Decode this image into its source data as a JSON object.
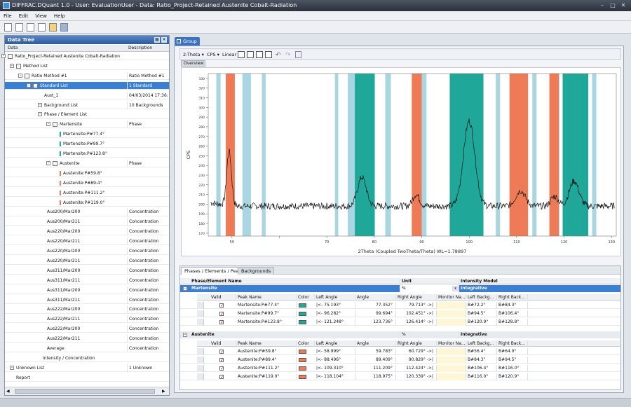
{
  "window": {
    "title": "DIFFRAC.DQuant 1.0 - User: EvaluationUser - Data: Ratio_Project-Retained Austenite Cobalt-Radiation",
    "min": "–",
    "max": "□",
    "close": "✕"
  },
  "menu": [
    "File",
    "Edit",
    "View",
    "Help"
  ],
  "toolbar": {
    "icons": [
      "new-document-icon",
      "open-document-icon",
      "document-icon",
      "document-icon",
      "open-folder-icon",
      "save-icon"
    ]
  },
  "data_tree": {
    "title": "Data Tree",
    "col_data": "Data",
    "col_description": "Description",
    "rows": [
      {
        "label": "Ratio_Project-Retained Austenite Cobalt-Radiation",
        "desc": ""
      },
      {
        "label": "Method List",
        "desc": ""
      },
      {
        "label": "Ratio Method #1",
        "desc": "Ratio Method #1"
      },
      {
        "label": "Standard List",
        "desc": "1 Standard"
      },
      {
        "label": "Aust_1",
        "desc": "04/03/2014 17:36:36"
      },
      {
        "label": "Background List",
        "desc": "10 Backgrounds"
      },
      {
        "label": "Phase / Element List",
        "desc": ""
      },
      {
        "label": "Martensite",
        "desc": "Phase"
      },
      {
        "label": "Martensite:P#77.4°",
        "desc": ""
      },
      {
        "label": "Martensite:P#99.7°",
        "desc": ""
      },
      {
        "label": "Martensite:P#123.8°",
        "desc": ""
      },
      {
        "label": "Austenite",
        "desc": "Phase"
      },
      {
        "label": "Austenite:P#59.8°",
        "desc": ""
      },
      {
        "label": "Austenite:P#89.4°",
        "desc": ""
      },
      {
        "label": "Austenite:P#111.2°",
        "desc": ""
      },
      {
        "label": "Austenite:P#119.0°",
        "desc": ""
      },
      {
        "label": "Aus200/Mar200",
        "desc": "Concentration"
      },
      {
        "label": "Aus200/Mar211",
        "desc": "Concentration"
      },
      {
        "label": "Aus220/Mar200",
        "desc": "Concentration"
      },
      {
        "label": "Aus220/Mar211",
        "desc": "Concentration"
      },
      {
        "label": "Aus220/Mar200",
        "desc": "Concentration"
      },
      {
        "label": "Aus220/Mar211",
        "desc": "Concentration"
      },
      {
        "label": "Aus311/Mar200",
        "desc": "Concentration"
      },
      {
        "label": "Aus311/Mar211",
        "desc": "Concentration"
      },
      {
        "label": "Aus311/Mar200",
        "desc": "Concentration"
      },
      {
        "label": "Aus311/Mar211",
        "desc": "Concentration"
      },
      {
        "label": "Aus222/Mar200",
        "desc": "Concentration"
      },
      {
        "label": "Aus222/Mar211",
        "desc": "Concentration"
      },
      {
        "label": "Aus222/Mar200",
        "desc": "Concentration"
      },
      {
        "label": "Aus222/Mar211",
        "desc": "Concentration"
      },
      {
        "label": "Average",
        "desc": "Concentration"
      },
      {
        "label": "Intensity / Concentration",
        "desc": ""
      },
      {
        "label": "Unknown List",
        "desc": "1 Unknown"
      },
      {
        "label": "Report",
        "desc": ""
      }
    ]
  },
  "group_tab": "Group",
  "chart_toolbar": {
    "xmode": "2-Theta",
    "ymode": "CPS",
    "scale": "Linear"
  },
  "overview_tab": "Overview",
  "chart_data": {
    "type": "line",
    "xlabel": "2Theta (Coupled TwoTheta/Theta) WL=1.78897",
    "ylabel": "CPS",
    "xlim": [
      45,
      131
    ],
    "ylim": [
      167,
      335
    ],
    "xticks": [
      50,
      60,
      70,
      80,
      90,
      100,
      110,
      120,
      130
    ],
    "xtick_labels": [
      "50",
      "",
      "70",
      "80",
      "90",
      "100",
      "110",
      "120",
      "130"
    ],
    "yticks": [
      170,
      180,
      190,
      200,
      210,
      220,
      230,
      240,
      250,
      260,
      270,
      280,
      290,
      300,
      310,
      320,
      330
    ],
    "martensite_color": "#1fa89a",
    "austenite_color": "#ef7a56",
    "background_color": "#a9d6e0",
    "background_bands": [
      [
        46.7,
        47.6
      ],
      [
        52.2,
        54.0
      ],
      [
        56.3,
        57.1
      ],
      [
        71.7,
        72.4
      ],
      [
        74.4,
        76.4
      ],
      [
        82.3,
        83.5
      ],
      [
        90.0,
        91.0
      ],
      [
        105.6,
        106.5
      ],
      [
        113.3,
        114.2
      ],
      [
        118.3,
        119.0
      ],
      [
        125.9,
        126.8
      ]
    ],
    "martensite_bands": [
      [
        75.9,
        80.1
      ],
      [
        95.9,
        103.0
      ],
      [
        119.7,
        125.1
      ]
    ],
    "austenite_bands": [
      [
        48.7,
        50.6
      ],
      [
        87.9,
        90.0
      ],
      [
        108.5,
        112.4
      ],
      [
        116.9,
        118.9
      ]
    ],
    "baseline": 198,
    "peaks": [
      {
        "x": 49.4,
        "height": 56,
        "width": 0.5
      },
      {
        "x": 77.4,
        "height": 30,
        "width": 0.9
      },
      {
        "x": 88.8,
        "height": 12,
        "width": 0.7
      },
      {
        "x": 100.0,
        "height": 88,
        "width": 1.2
      },
      {
        "x": 110.8,
        "height": 16,
        "width": 1.0
      },
      {
        "x": 118.0,
        "height": 10,
        "width": 0.8
      },
      {
        "x": 122.1,
        "height": 26,
        "width": 1.0
      }
    ]
  },
  "bottom_tabs": [
    "Phases / Elements / Peaks",
    "Backgrounds"
  ],
  "grid_header": {
    "name": "Phase/Element Name",
    "unit": "Unit",
    "model": "Intensity Model"
  },
  "peak_cols": [
    "Valid",
    "Peak Name",
    "Color",
    "Left Angle",
    "Angle",
    "Right Angle",
    "Monitor Na...",
    "Left Backg...",
    "Right Back..."
  ],
  "phases": [
    {
      "name": "Martensite",
      "unit": "%",
      "model": "Integrative",
      "color": "#1fa89a",
      "peaks": [
        {
          "name": "Martensite:P#77.4°",
          "left": "|<- 75.193°",
          "angle": "77.352°",
          "right": "79.713° ->|",
          "lb": "B#72.2°",
          "rb": "B#84.3°"
        },
        {
          "name": "Martensite:P#99.7°",
          "left": "|<- 96.282°",
          "angle": "99.694°",
          "right": "102.451° ->|",
          "lb": "B#94.5°",
          "rb": "B#106.4°"
        },
        {
          "name": "Martensite:P#123.8°",
          "left": "|<- 121.248°",
          "angle": "123.736°",
          "right": "126.414° ->|",
          "lb": "B#120.9°",
          "rb": "B#128.8°"
        }
      ]
    },
    {
      "name": "Austenite",
      "unit": "%",
      "model": "Integrative",
      "color": "#ef7a56",
      "peaks": [
        {
          "name": "Austenite:P#59.8°",
          "left": "|<- 58.999°",
          "angle": "59.783°",
          "right": "60.729° ->|",
          "lb": "B#56.4°",
          "rb": "B#64.0°"
        },
        {
          "name": "Austenite:P#89.4°",
          "left": "|<- 88.496°",
          "angle": "89.409°",
          "right": "90.829° ->|",
          "lb": "B#84.3°",
          "rb": "B#94.5°"
        },
        {
          "name": "Austenite:P#111.2°",
          "left": "|<- 109.310°",
          "angle": "111.209°",
          "right": "112.424° ->|",
          "lb": "B#106.4°",
          "rb": "B#116.0°"
        },
        {
          "name": "Austenite:P#119.0°",
          "left": "|<- 118.104°",
          "angle": "118.975°",
          "right": "120.339° ->|",
          "lb": "B#116.0°",
          "rb": "B#120.9°"
        }
      ]
    }
  ]
}
